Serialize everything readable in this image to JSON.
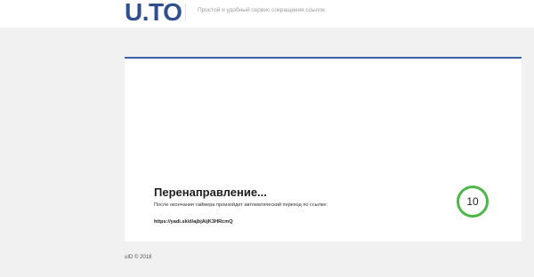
{
  "header": {
    "logo": "U.TO",
    "tagline": "Простой и удобный сервис сокращения ссылок"
  },
  "redirect": {
    "title": "Перенаправление...",
    "description": "После окончания таймера произойдет автоматический переход по ссылке:",
    "link": "https://yadi.sk/d/ajbjAijK3HRcmQ",
    "timer": "10"
  },
  "footer": {
    "copyright": "uID © 2018"
  },
  "colors": {
    "brand": "#2f4f8f",
    "accent_border": "#3d61a9",
    "timer_ring": "#4cb748",
    "page_background": "#f1f1f1"
  }
}
